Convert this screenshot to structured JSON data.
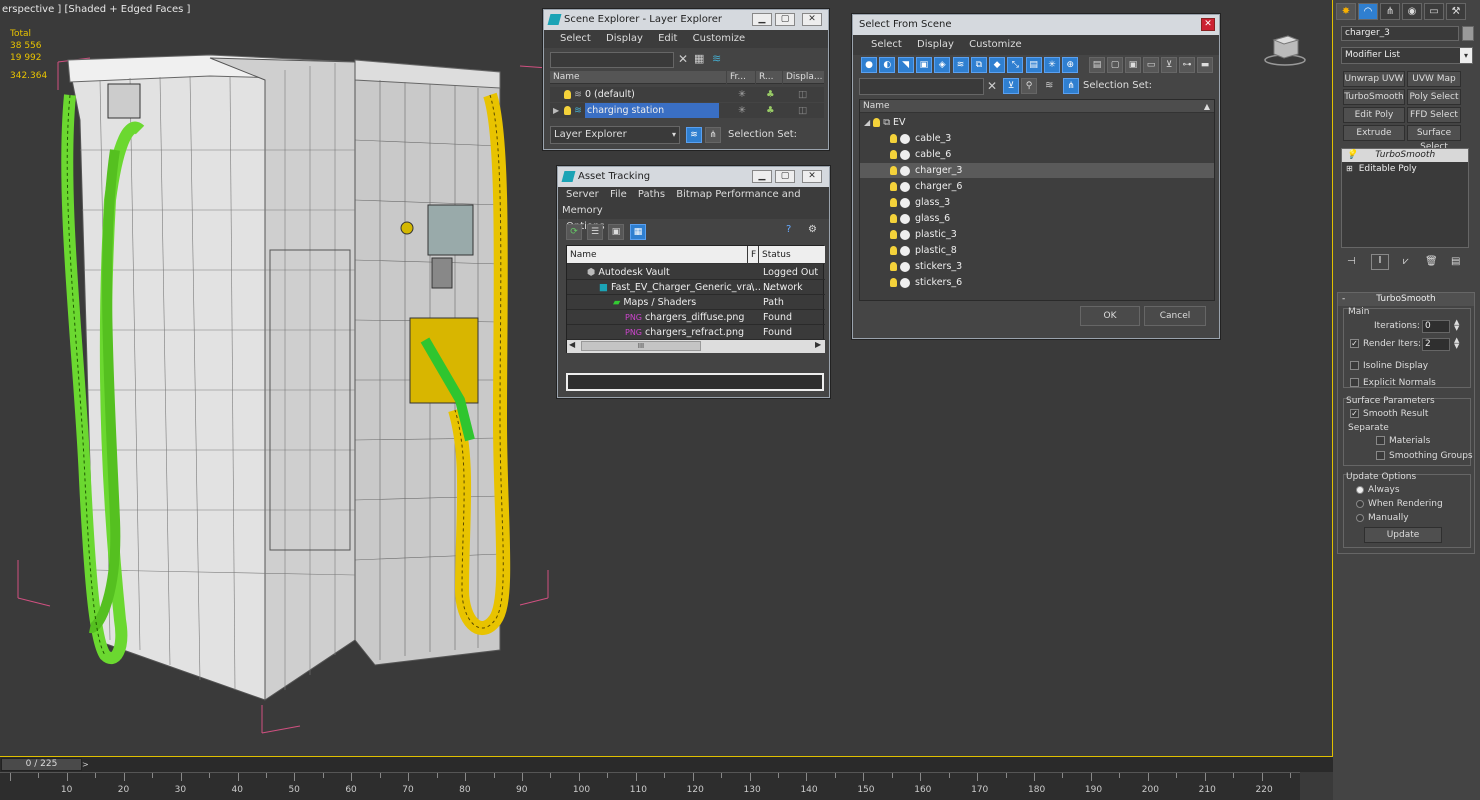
{
  "viewport": {
    "label": "erspective ] [Shaded + Edged Faces ]",
    "stats": [
      "Total",
      "38 556",
      "19 992",
      "342.364"
    ]
  },
  "timeline": {
    "frame": "0 / 225",
    "next": ">",
    "ticks": [
      "10",
      "20",
      "30",
      "40",
      "50",
      "60",
      "70",
      "80",
      "90",
      "100",
      "110",
      "120",
      "130",
      "140",
      "150",
      "160",
      "170",
      "180",
      "190",
      "200",
      "210",
      "220"
    ]
  },
  "scene_explorer": {
    "title": "Scene Explorer - Layer Explorer",
    "menu": [
      "Select",
      "Display",
      "Edit",
      "Customize"
    ],
    "columns": [
      "Name",
      "Fr...",
      "R...",
      "Displa..."
    ],
    "rows": [
      {
        "name": "0 (default)"
      },
      {
        "name": "charging station"
      }
    ],
    "footer_dropdown": "Layer Explorer",
    "selection_set": "Selection Set:"
  },
  "asset_tracking": {
    "title": "Asset Tracking",
    "menu": [
      "Server",
      "File",
      "Paths",
      "Bitmap Performance and Memory"
    ],
    "menu2": "Options",
    "columns": [
      "Name",
      "F",
      "Status"
    ],
    "rows": [
      {
        "name": "Autodesk Vault",
        "f": "",
        "status": "Logged Out ..."
      },
      {
        "name": "Fast_EV_Charger_Generic_vra...",
        "f": "\\",
        "status": "Network Path"
      },
      {
        "name": "Maps / Shaders",
        "f": "",
        "status": ""
      },
      {
        "name": "chargers_diffuse.png",
        "f": "",
        "status": "Found"
      },
      {
        "name": "chargers_refract.png",
        "f": "",
        "status": "Found"
      }
    ],
    "scroll_center": "III"
  },
  "select_from_scene": {
    "title": "Select From Scene",
    "menu": [
      "Select",
      "Display",
      "Customize"
    ],
    "selection_set": "Selection Set:",
    "column": "Name",
    "root": "EV",
    "items": [
      "cable_3",
      "cable_6",
      "charger_3",
      "charger_6",
      "glass_3",
      "glass_6",
      "plastic_3",
      "plastic_8",
      "stickers_3",
      "stickers_6"
    ],
    "selected_index": 2,
    "ok": "OK",
    "cancel": "Cancel"
  },
  "command_panel": {
    "object_name": "charger_3",
    "modifier_list": "Modifier List",
    "buttons": [
      "Unwrap UVW",
      "UVW Map",
      "TurboSmooth",
      "Poly Select",
      "Edit Poly",
      "FFD Select",
      "Extrude",
      "Surface Select"
    ],
    "stack": [
      "TurboSmooth",
      "Editable Poly"
    ],
    "rollout_title": "TurboSmooth",
    "main_label": "Main",
    "iterations_label": "Iterations:",
    "iterations_value": "0",
    "render_iters_label": "Render Iters:",
    "render_iters_value": "2",
    "isoline": "Isoline Display",
    "explicit": "Explicit Normals",
    "surface_params": "Surface Parameters",
    "smooth_result": "Smooth Result",
    "separate": "Separate",
    "materials": "Materials",
    "smoothing_groups": "Smoothing Groups",
    "update_options": "Update Options",
    "always": "Always",
    "when_rendering": "When Rendering",
    "manually": "Manually",
    "update": "Update"
  }
}
